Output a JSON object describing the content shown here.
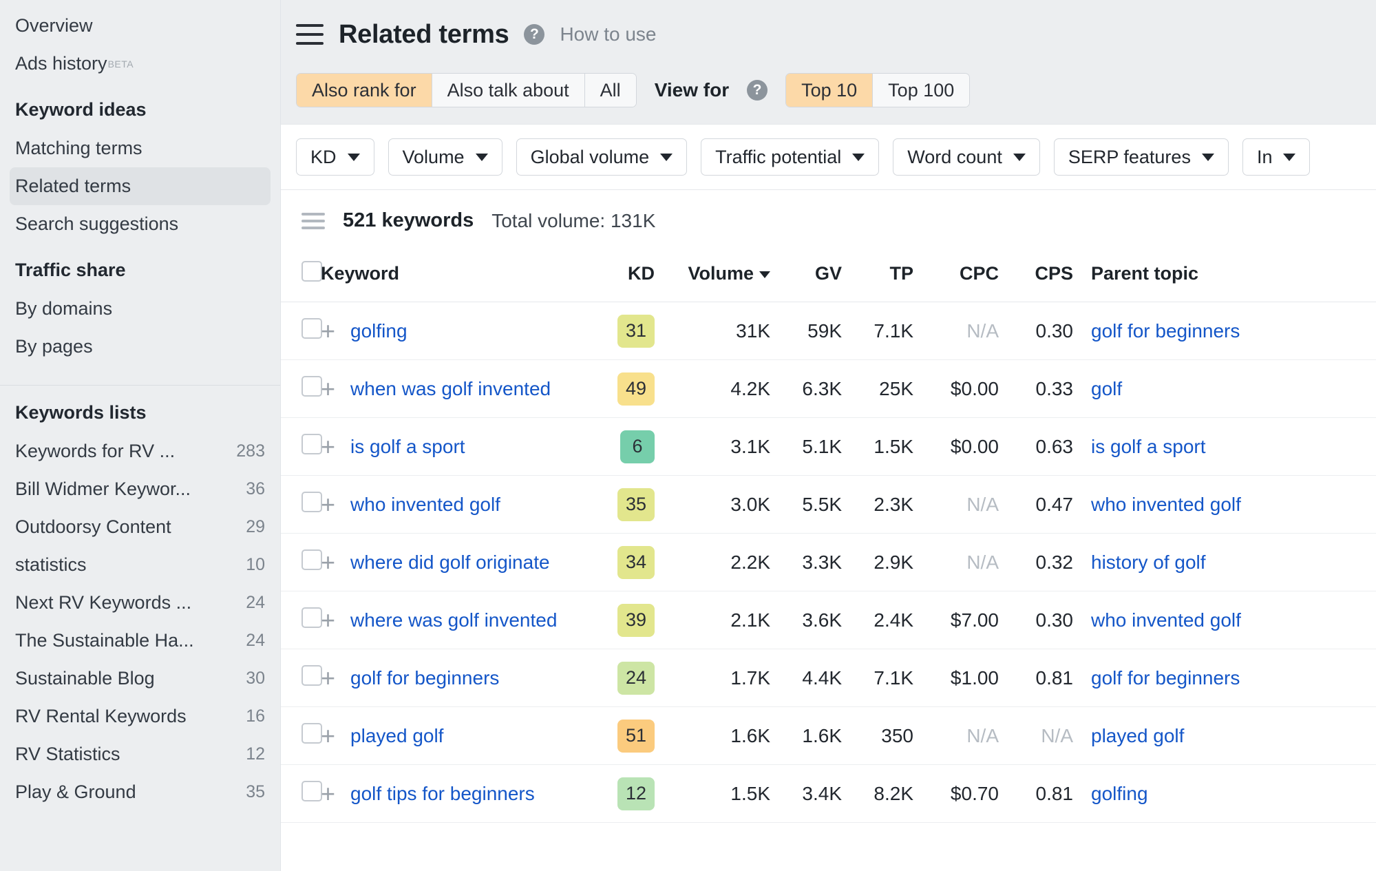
{
  "sidebar": {
    "top_items": [
      {
        "label": "Overview",
        "badge": "",
        "active": false
      },
      {
        "label": "Ads history",
        "badge": "BETA",
        "active": false
      }
    ],
    "keyword_ideas_heading": "Keyword ideas",
    "keyword_ideas_items": [
      {
        "label": "Matching terms",
        "active": false
      },
      {
        "label": "Related terms",
        "active": true
      },
      {
        "label": "Search suggestions",
        "active": false
      }
    ],
    "traffic_share_heading": "Traffic share",
    "traffic_share_items": [
      {
        "label": "By domains",
        "active": false
      },
      {
        "label": "By pages",
        "active": false
      }
    ],
    "keywords_lists_heading": "Keywords lists",
    "keywords_lists": [
      {
        "label": "Keywords for RV ...",
        "count": "283"
      },
      {
        "label": "Bill Widmer Keywor...",
        "count": "36"
      },
      {
        "label": "Outdoorsy Content",
        "count": "29"
      },
      {
        "label": "statistics",
        "count": "10"
      },
      {
        "label": "Next RV Keywords ...",
        "count": "24"
      },
      {
        "label": "The Sustainable Ha...",
        "count": "24"
      },
      {
        "label": "Sustainable Blog",
        "count": "30"
      },
      {
        "label": "RV Rental Keywords",
        "count": "16"
      },
      {
        "label": "RV Statistics",
        "count": "12"
      },
      {
        "label": "Play & Ground",
        "count": "35"
      }
    ]
  },
  "header": {
    "title": "Related terms",
    "help_icon": "?",
    "how_to_use": "How to use"
  },
  "tabs": {
    "mode_options": [
      {
        "label": "Also rank for",
        "selected": true
      },
      {
        "label": "Also talk about",
        "selected": false
      },
      {
        "label": "All",
        "selected": false
      }
    ],
    "view_for_label": "View for",
    "view_for_help": "?",
    "view_options": [
      {
        "label": "Top 10",
        "selected": true
      },
      {
        "label": "Top 100",
        "selected": false
      }
    ]
  },
  "filters": [
    {
      "label": "KD"
    },
    {
      "label": "Volume"
    },
    {
      "label": "Global volume"
    },
    {
      "label": "Traffic potential"
    },
    {
      "label": "Word count"
    },
    {
      "label": "SERP features"
    },
    {
      "label": "In"
    }
  ],
  "results": {
    "keyword_count": "521 keywords",
    "total_volume": "Total volume: 131K"
  },
  "table": {
    "columns": [
      "Keyword",
      "KD",
      "Volume",
      "GV",
      "TP",
      "CPC",
      "CPS",
      "Parent topic"
    ],
    "sorted_column": "Volume",
    "sort_direction": "desc",
    "rows": [
      {
        "keyword": "golfing",
        "kd": "31",
        "kd_color": "#e2e68d",
        "volume": "31K",
        "gv": "59K",
        "tp": "7.1K",
        "cpc": "N/A",
        "cps": "0.30",
        "parent_topic": "golf for beginners"
      },
      {
        "keyword": "when was golf invented",
        "kd": "49",
        "kd_color": "#f8e08c",
        "volume": "4.2K",
        "gv": "6.3K",
        "tp": "25K",
        "cpc": "$0.00",
        "cps": "0.33",
        "parent_topic": "golf"
      },
      {
        "keyword": "is golf a sport",
        "kd": "6",
        "kd_color": "#76ceab",
        "volume": "3.1K",
        "gv": "5.1K",
        "tp": "1.5K",
        "cpc": "$0.00",
        "cps": "0.63",
        "parent_topic": "is golf a sport"
      },
      {
        "keyword": "who invented golf",
        "kd": "35",
        "kd_color": "#e2e68d",
        "volume": "3.0K",
        "gv": "5.5K",
        "tp": "2.3K",
        "cpc": "N/A",
        "cps": "0.47",
        "parent_topic": "who invented golf"
      },
      {
        "keyword": "where did golf originate",
        "kd": "34",
        "kd_color": "#e2e68d",
        "volume": "2.2K",
        "gv": "3.3K",
        "tp": "2.9K",
        "cpc": "N/A",
        "cps": "0.32",
        "parent_topic": "history of golf"
      },
      {
        "keyword": "where was golf invented",
        "kd": "39",
        "kd_color": "#e2e68d",
        "volume": "2.1K",
        "gv": "3.6K",
        "tp": "2.4K",
        "cpc": "$7.00",
        "cps": "0.30",
        "parent_topic": "who invented golf"
      },
      {
        "keyword": "golf for beginners",
        "kd": "24",
        "kd_color": "#cde5a4",
        "volume": "1.7K",
        "gv": "4.4K",
        "tp": "7.1K",
        "cpc": "$1.00",
        "cps": "0.81",
        "parent_topic": "golf for beginners"
      },
      {
        "keyword": "played golf",
        "kd": "51",
        "kd_color": "#fbcb7e",
        "volume": "1.6K",
        "gv": "1.6K",
        "tp": "350",
        "cpc": "N/A",
        "cps": "N/A",
        "parent_topic": "played golf"
      },
      {
        "keyword": "golf tips for beginners",
        "kd": "12",
        "kd_color": "#b9e3b5",
        "volume": "1.5K",
        "gv": "3.4K",
        "tp": "8.2K",
        "cpc": "$0.70",
        "cps": "0.81",
        "parent_topic": "golfing"
      }
    ]
  }
}
